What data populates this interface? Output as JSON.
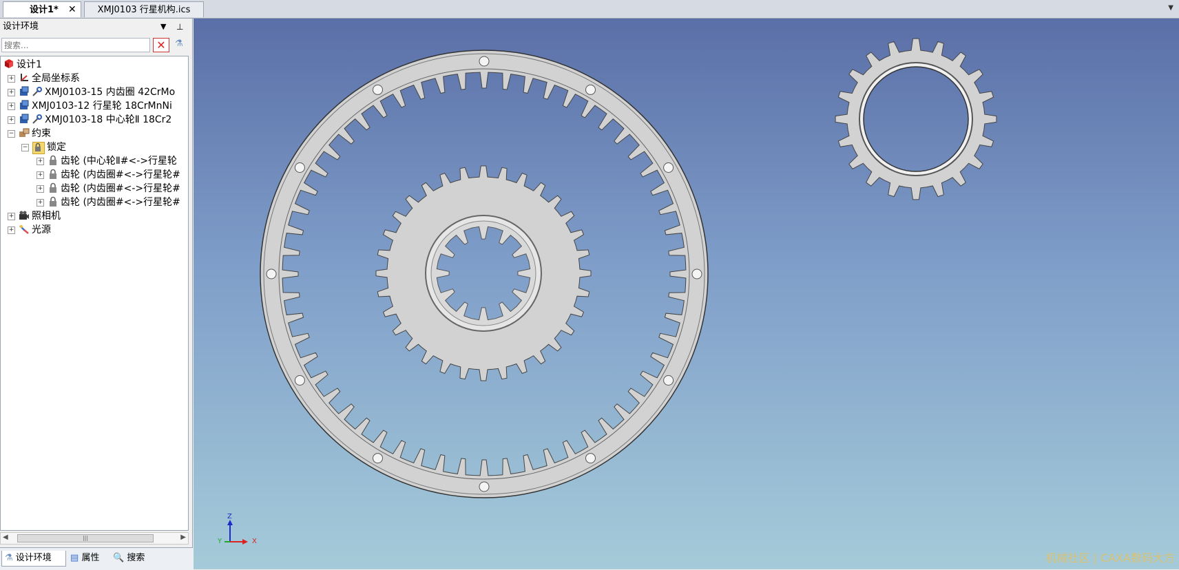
{
  "tabs": [
    {
      "label": "设计1*",
      "close": "✕"
    },
    {
      "label": "XMJ0103 行星机构.ics"
    }
  ],
  "panel": {
    "title": "设计环境",
    "dropdown_icon": "▼",
    "pin_icon": "⊥"
  },
  "search": {
    "placeholder": "搜索..."
  },
  "tree": [
    {
      "label": "设计1"
    },
    {
      "label": "全局坐标系"
    },
    {
      "label": "XMJ0103-15 内齿圈 42CrMo"
    },
    {
      "label": "XMJ0103-12 行星轮 18CrMnNi"
    },
    {
      "label": "XMJ0103-18 中心轮Ⅱ 18Cr2"
    },
    {
      "label": "约束"
    },
    {
      "label": "锁定"
    },
    {
      "label": "齿轮 (中心轮Ⅱ#<->行星轮"
    },
    {
      "label": "齿轮 (内齿圈#<->行星轮#"
    },
    {
      "label": "齿轮 (内齿圈#<->行星轮#"
    },
    {
      "label": "齿轮 (内齿圈#<->行星轮#"
    },
    {
      "label": "照相机"
    },
    {
      "label": "光源"
    }
  ],
  "bottom_tabs": [
    {
      "label": "设计环境"
    },
    {
      "label": "属性"
    },
    {
      "label": "搜索"
    }
  ],
  "axes": {
    "z": "Z",
    "y": "Y",
    "x": "X"
  },
  "watermark": "机械社区 | CAXA数码大方",
  "gears": {
    "ring_teeth": 56,
    "ring_bolts": 12,
    "sun_teeth": 32,
    "planet_teeth": 20,
    "spline_teeth": 12
  },
  "colors": {
    "viewport_top": "#5a6fa7",
    "viewport_bottom": "#a5cbd9",
    "gear": "#d2d2d2"
  }
}
